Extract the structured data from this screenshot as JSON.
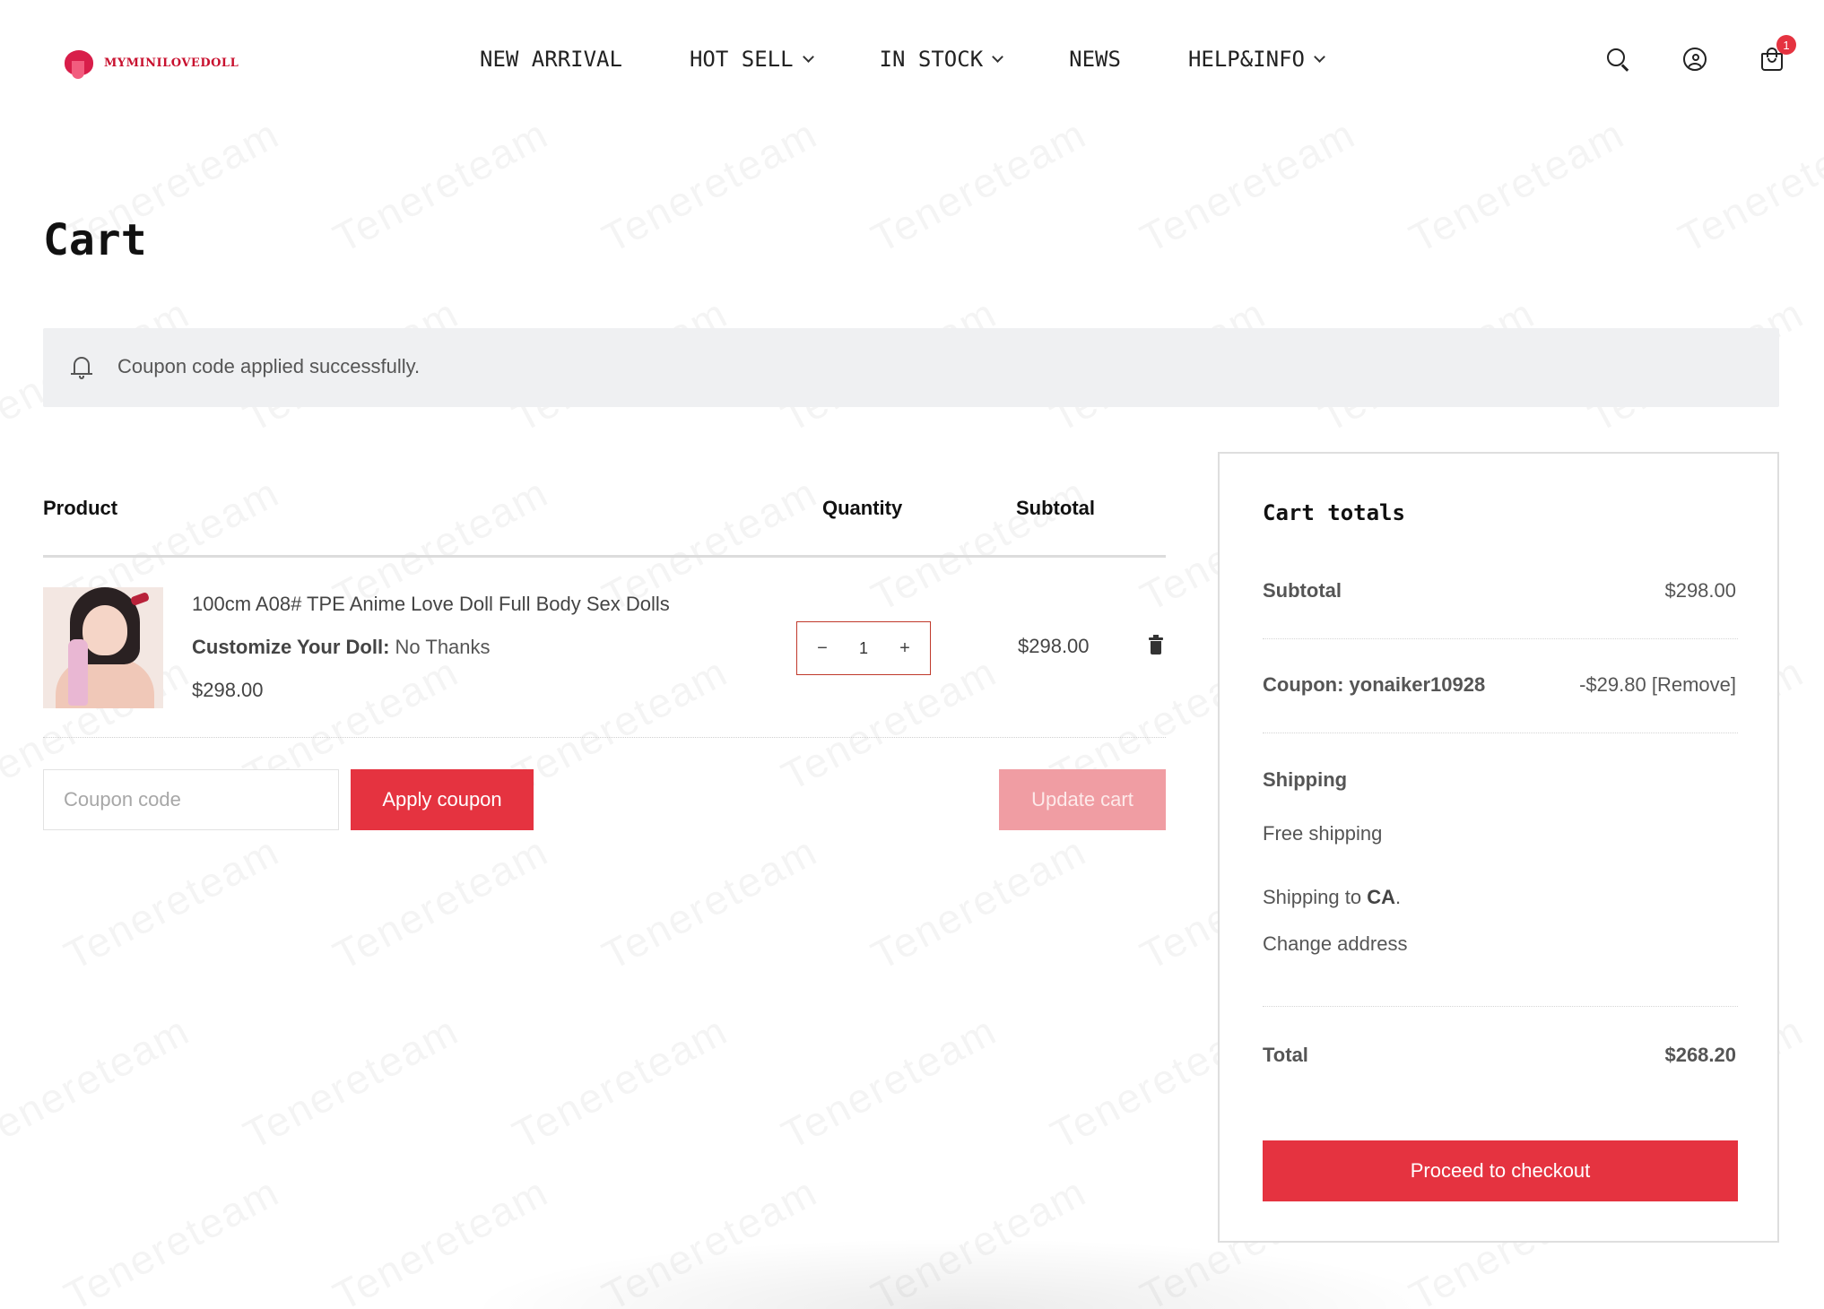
{
  "brand": {
    "name": "MYMINILOVEDOLL",
    "accent_color": "#e53340"
  },
  "nav": {
    "items": [
      {
        "label": "NEW ARRIVAL",
        "has_dropdown": false
      },
      {
        "label": "HOT SELL",
        "has_dropdown": true
      },
      {
        "label": "IN STOCK",
        "has_dropdown": true
      },
      {
        "label": "NEWS",
        "has_dropdown": false
      },
      {
        "label": "HELP&INFO",
        "has_dropdown": true
      }
    ]
  },
  "header_icons": {
    "search": "search-icon",
    "account": "account-icon",
    "cart": "cart-bag-icon",
    "cart_count": "1"
  },
  "page": {
    "title": "Cart"
  },
  "notice": {
    "icon": "bell-icon",
    "text": "Coupon code applied successfully."
  },
  "cart_table": {
    "headers": {
      "product": "Product",
      "quantity": "Quantity",
      "subtotal": "Subtotal"
    },
    "items": [
      {
        "name": "100cm A08# TPE Anime Love Doll Full Body Sex Dolls",
        "option_label": "Customize Your Doll:",
        "option_value": "No Thanks",
        "price": "$298.00",
        "quantity": "1",
        "subtotal": "$298.00"
      }
    ],
    "qty_minus": "−",
    "qty_plus": "+"
  },
  "coupon": {
    "placeholder": "Coupon code",
    "apply_label": "Apply coupon",
    "update_label": "Update cart"
  },
  "totals": {
    "title": "Cart totals",
    "subtotal_label": "Subtotal",
    "subtotal_value": "$298.00",
    "coupon_label": "Coupon: yonaiker10928",
    "coupon_value": "-$29.80",
    "coupon_remove": "[Remove]",
    "shipping_label": "Shipping",
    "shipping_method": "Free shipping",
    "shipping_to_prefix": "Shipping to",
    "shipping_to_region": "CA",
    "change_address": "Change address",
    "total_label": "Total",
    "total_value": "$268.20",
    "checkout_label": "Proceed to checkout"
  }
}
